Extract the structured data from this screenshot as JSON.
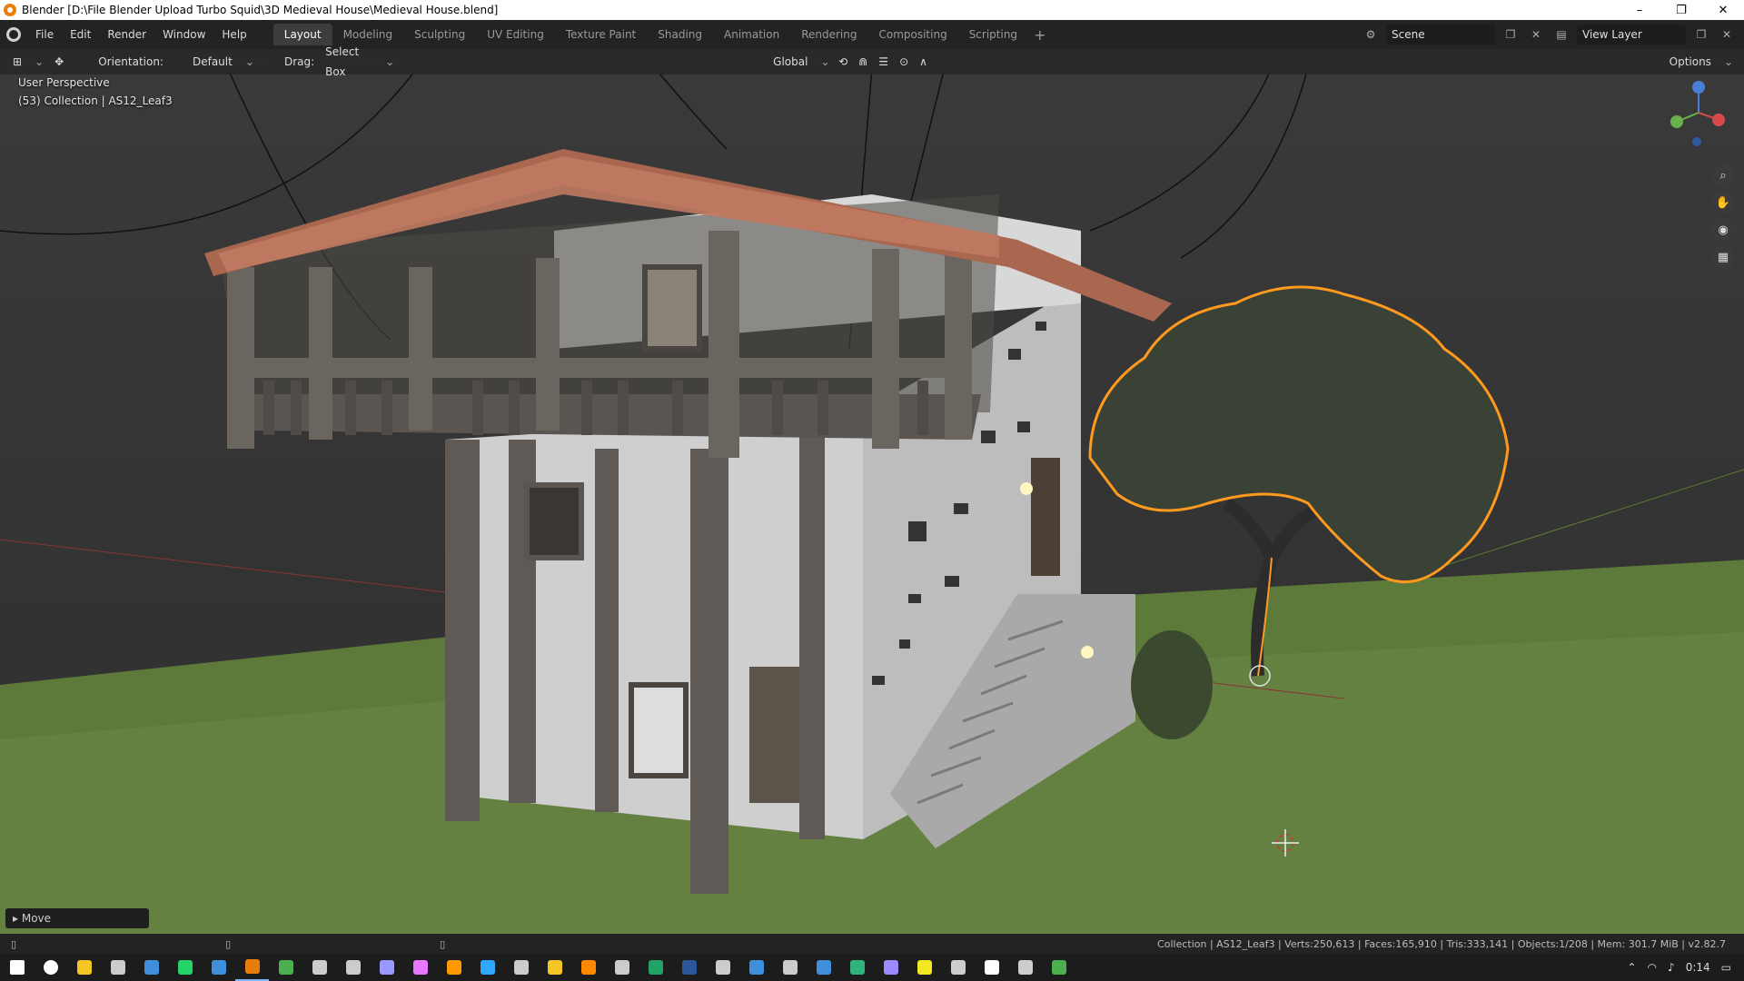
{
  "window": {
    "title": "Blender [D:\\File Blender Upload Turbo Squid\\3D Medieval House\\Medieval House.blend]",
    "minimize": "–",
    "maximize": "❐",
    "close": "✕"
  },
  "menu": {
    "items": [
      "File",
      "Edit",
      "Render",
      "Window",
      "Help"
    ]
  },
  "workspaces": {
    "tabs": [
      "Layout",
      "Modeling",
      "Sculpting",
      "UV Editing",
      "Texture Paint",
      "Shading",
      "Animation",
      "Rendering",
      "Compositing",
      "Scripting"
    ],
    "active": "Layout",
    "add": "+"
  },
  "scene": {
    "scene_name": "Scene",
    "view_layer": "View Layer"
  },
  "viewport_header": {
    "orientation_label": "Orientation:",
    "orientation_value": "Default",
    "drag_label": "Drag:",
    "drag_value": "Select Box",
    "transform_space": "Global",
    "options": "Options"
  },
  "viewport": {
    "perspective": "User Perspective",
    "collection_info": "(53) Collection | AS12_Leaf3"
  },
  "operator_panel": {
    "label": "Move"
  },
  "status": {
    "stats": "Collection | AS12_Leaf3 | Verts:250,613 | Faces:165,910 | Tris:333,141 | Objects:1/208 | Mem: 301.7 MiB | v2.82.7"
  },
  "taskbar": {
    "clock": "0:14",
    "icons": [
      "start-icon",
      "search-icon",
      "file-explorer-icon",
      "settings-icon",
      "store-icon",
      "whatsapp-icon",
      "mail-icon",
      "blender-icon",
      "chrome-icon",
      "terminal-icon",
      "media-icon",
      "after-effects-icon",
      "premiere-icon",
      "illustrator-icon",
      "photoshop-icon",
      "app-icon",
      "folder-icon",
      "vlc-icon",
      "app2-icon",
      "excel-icon",
      "word-icon",
      "steam-icon",
      "app3-icon",
      "app4-icon",
      "app5-icon",
      "edge-icon",
      "app6-icon",
      "notes-icon",
      "calculator-icon",
      "app7-icon",
      "app8-icon",
      "app9-icon"
    ],
    "icon_colors": [
      "#ffffff",
      "#ffffff",
      "#f3c623",
      "#cccccc",
      "#3f8fdc",
      "#25d366",
      "#3f8fdc",
      "#e87d0d",
      "#4caf50",
      "#cccccc",
      "#cccccc",
      "#9999ff",
      "#ea77ff",
      "#ff9a00",
      "#31a8ff",
      "#cccccc",
      "#f3c623",
      "#ff8800",
      "#cccccc",
      "#21a366",
      "#2b579a",
      "#cccccc",
      "#3f8fdc",
      "#cccccc",
      "#3f8fdc",
      "#2fb37a",
      "#9c88ff",
      "#f3e623",
      "#cccccc",
      "#ffffff",
      "#cccccc",
      "#4caf50"
    ]
  }
}
